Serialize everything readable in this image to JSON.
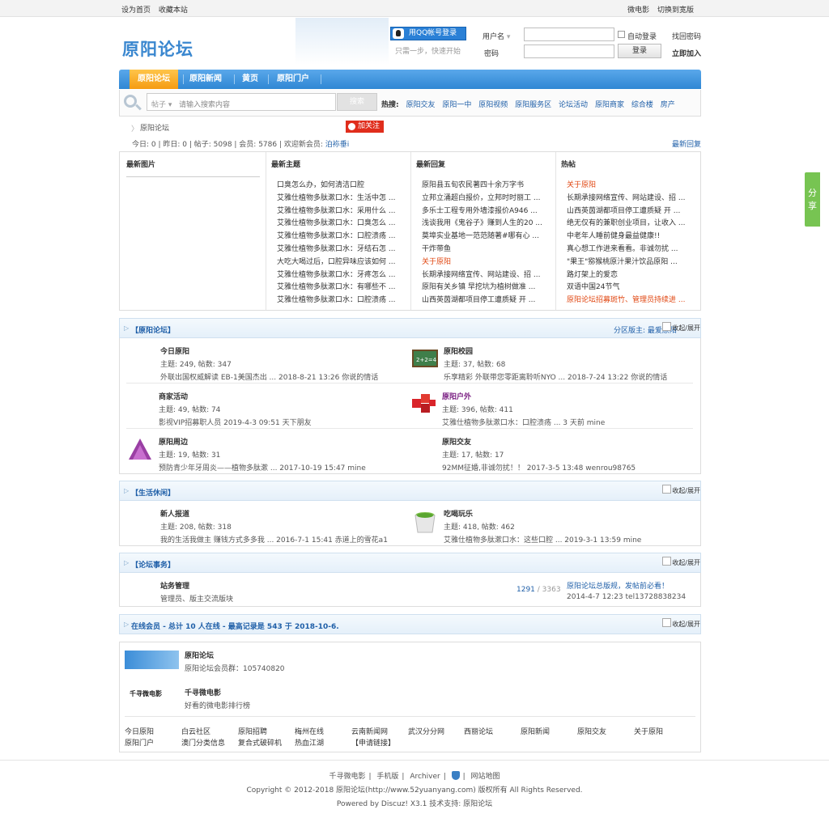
{
  "topbar": {
    "set_home": "设为首页",
    "bookmark": "收藏本站",
    "weibo": "微电影",
    "wide": "切换到宽版"
  },
  "logo": "原阳论坛",
  "login": {
    "qq_label": "用QQ帐号登录",
    "qq_note": "只需一步，快速开始",
    "user_label": "用户名",
    "pass_label": "密码",
    "auto_login": "自动登录",
    "find_pass": "找回密码",
    "submit": "登录",
    "register": "立即加入"
  },
  "nav": {
    "items": [
      "原阳论坛",
      "原阳新闻",
      "黄页",
      "原阳门户"
    ]
  },
  "search": {
    "select": "帖子",
    "placeholder": "请输入搜索内容",
    "button": "搜索",
    "hot_label": "热搜:",
    "hot": [
      "原阳交友",
      "原阳一中",
      "原阳视频",
      "原阳服务区",
      "论坛活动",
      "原阳商家",
      "综合楼",
      "房产"
    ]
  },
  "crumb": "原阳论坛",
  "follow": "加关注",
  "stats": {
    "text": "今日: 0 | 昨日: 0 | 帖子: 5098 | 会员: 5786 | 欢迎新会员: ",
    "new_member": "泊袮垂i",
    "latest": "最新回复"
  },
  "grid": {
    "h_pic": "最新图片",
    "h_new": "最新主题",
    "h_reply": "最新回复",
    "h_hot": "热帖",
    "new_topics": [
      "口臭怎么办，如何清洁口腔",
      "艾雅仕植物多肽漱口水：生活中怎 ...",
      "艾雅仕植物多肽漱口水：采用什么 ...",
      "艾雅仕植物多肽漱口水：口臭怎么 ...",
      "艾雅仕植物多肽漱口水：口腔溃疡 ...",
      "艾雅仕植物多肽漱口水：牙结石怎 ...",
      "大吃大喝过后，口腔异味应该如何 ...",
      "艾雅仕植物多肽漱口水：牙疼怎么 ...",
      "艾雅仕植物多肽漱口水：有哪些不 ...",
      "艾雅仕植物多肽漱口水：口腔溃疡 ..."
    ],
    "new_replies": [
      "原阳县五旬农民著四十余万字书",
      "立邦立涌超白报价，立邦时时丽工 ...",
      "多乐士工程专用外墙漆报价A946 ...",
      "浅谈我用《鬼谷子》赚到人生的20 ...",
      "莫埠实业基地一范范随著#哪有心 ...",
      "干炸带鱼",
      "关于原阳",
      "长期承接网络宣传、网站建设、招 ...",
      "原阳有关乡镇 早挖坑为植树做准 ...",
      "山西英茵湖都项目停工遭质疑 开 ..."
    ],
    "hot": [
      "关于原阳",
      "长期承接网络宣传、网站建设、招 ...",
      "山西英茵湖都项目停工遭质疑 开 ...",
      "绝无仅有的兼职创业项目，让收入 ...",
      "中老年人睡前健身最益健康!!",
      "真心想工作进来看看。非诚勿扰 ...",
      "\"果王\"猕猴桃原汁果汁饮品原阳 ...",
      "路灯架上的爱恋",
      "双语中国24节气",
      "原阳论坛招募斑竹、管理员持续进 ..."
    ]
  },
  "sec1": {
    "title": "【原阳论坛】",
    "collapse": "收起/展开",
    "mods": "分区版主: 最爱原阳",
    "forums": [
      {
        "name": "今日原阳",
        "counts": "主题: 249, 帖数: 347",
        "last": "外联出国权威解读 EB-1美国杰出 ... 2018-8-21 13:26 你说的情话"
      },
      {
        "name": "原阳校园",
        "counts": "主题: 37, 帖数: 68",
        "last": "乐享精彩 外联带您零距离聆听NYO ... 2018-7-24 13:22 你说的情话"
      },
      {
        "name": "商家活动",
        "counts": "主题: 49, 帖数: 74",
        "last": "影视VIP招募职人员 2019-4-3 09:51 天下朋友"
      },
      {
        "name": "原阳户外",
        "counts": "主题: 396, 帖数: 411",
        "last": "艾雅仕植物多肽漱口水：口腔溃疡 ... 3 天前 mine"
      },
      {
        "name": "原阳周边",
        "counts": "主题: 19, 帖数: 31",
        "last": "预防青少年牙周炎——植物多肽漱 ... 2017-10-19 15:47 mine"
      },
      {
        "name": "原阳交友",
        "counts": "主题: 17, 帖数: 17",
        "last": "92MM征婚,非诚勿扰！！ 2017-3-5 13:48 wenrou98765"
      }
    ]
  },
  "sec2": {
    "title": "【生活休闲】",
    "collapse": "收起/展开",
    "forums": [
      {
        "name": "新人报道",
        "counts": "主题: 208, 帖数: 318",
        "last": "我的生活我做主 赚钱方式多多我 ... 2016-7-1 15:41 赤道上的雪花a1"
      },
      {
        "name": "吃喝玩乐",
        "counts": "主题: 418, 帖数: 462",
        "last": "艾雅仕植物多肽漱口水：这些口腔 ... 2019-3-1 13:59 mine"
      }
    ]
  },
  "sec3": {
    "title": "【论坛事务】",
    "collapse": "收起/展开",
    "forum": {
      "name": "站务管理",
      "desc": "管理员、版主交流版块",
      "count_a": "1291",
      "count_b": "/ 3363",
      "last_title": "原阳论坛总版规，发帖前必看！",
      "last_meta": "2014-4-7 12:23 tel13728838234"
    }
  },
  "online": {
    "title": "在线会员 - 总计 10 人在线 - 最高记录是 543 于 2018-10-6.",
    "collapse": "收起/展开"
  },
  "links": {
    "site1": {
      "name": "原阳论坛",
      "desc": "原阳论坛会员群：105740820"
    },
    "site2": {
      "name": "千寻微电影",
      "desc": "好看的微电影排行榜",
      "logo": "千寻微电影"
    },
    "row1": [
      "今日原阳",
      "白云社区",
      "原阳招聘",
      "梅州在线",
      "云南新闻网",
      "武汉分分网",
      "西丽论坛",
      "原阳新闻",
      "原阳交友",
      "关于原阳"
    ],
    "row2": [
      "原阳门户",
      "澳门分类信息",
      "复合式破碎机",
      "热血江湖",
      "【申请链接】"
    ]
  },
  "footer": {
    "links": [
      "千寻微电影",
      "手机版",
      "Archiver",
      "网站地图"
    ],
    "copyright": "Copyright © 2012-2018 原阳论坛(http://www.52yuanyang.com) 版权所有 All Rights Reserved.",
    "powered": "Powered by Discuz! X3.1  技术支持: 原阳论坛"
  },
  "share": "分享"
}
